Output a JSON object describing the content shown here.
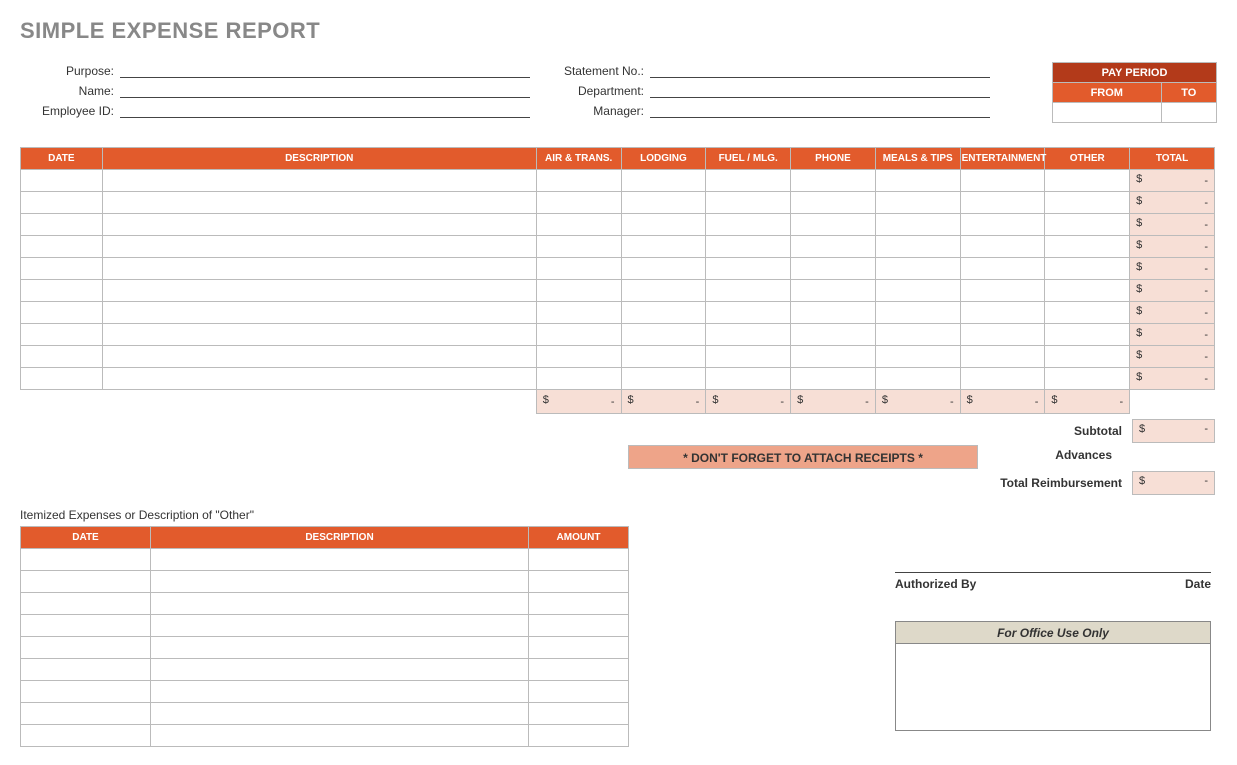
{
  "title": "SIMPLE EXPENSE REPORT",
  "meta": {
    "purpose_label": "Purpose:",
    "name_label": "Name:",
    "employee_id_label": "Employee ID:",
    "statement_no_label": "Statement No.:",
    "department_label": "Department:",
    "manager_label": "Manager:"
  },
  "pay_period": {
    "header": "PAY PERIOD",
    "from_label": "FROM",
    "to_label": "TO",
    "from_value": "",
    "to_value": ""
  },
  "expense_headers": {
    "date": "DATE",
    "description": "DESCRIPTION",
    "air_trans": "AIR & TRANS.",
    "lodging": "LODGING",
    "fuel_mlg": "FUEL / MLG.",
    "phone": "PHONE",
    "meals_tips": "MEALS & TIPS",
    "entertainment": "ENTERTAINMENT",
    "other": "OTHER",
    "total": "TOTAL"
  },
  "currency": "$",
  "dash": "-",
  "row_count": 10,
  "summary": {
    "subtotal_label": "Subtotal",
    "advances_label": "Advances",
    "total_reimb_label": "Total Reimbursement"
  },
  "reminder": "* DON'T FORGET TO ATTACH RECEIPTS *",
  "itemized": {
    "caption": "Itemized Expenses or Description of \"Other\"",
    "headers": {
      "date": "DATE",
      "description": "DESCRIPTION",
      "amount": "AMOUNT"
    },
    "row_count": 9
  },
  "auth": {
    "by_label": "Authorized By",
    "date_label": "Date"
  },
  "office_box": {
    "header": "For Office Use Only"
  }
}
